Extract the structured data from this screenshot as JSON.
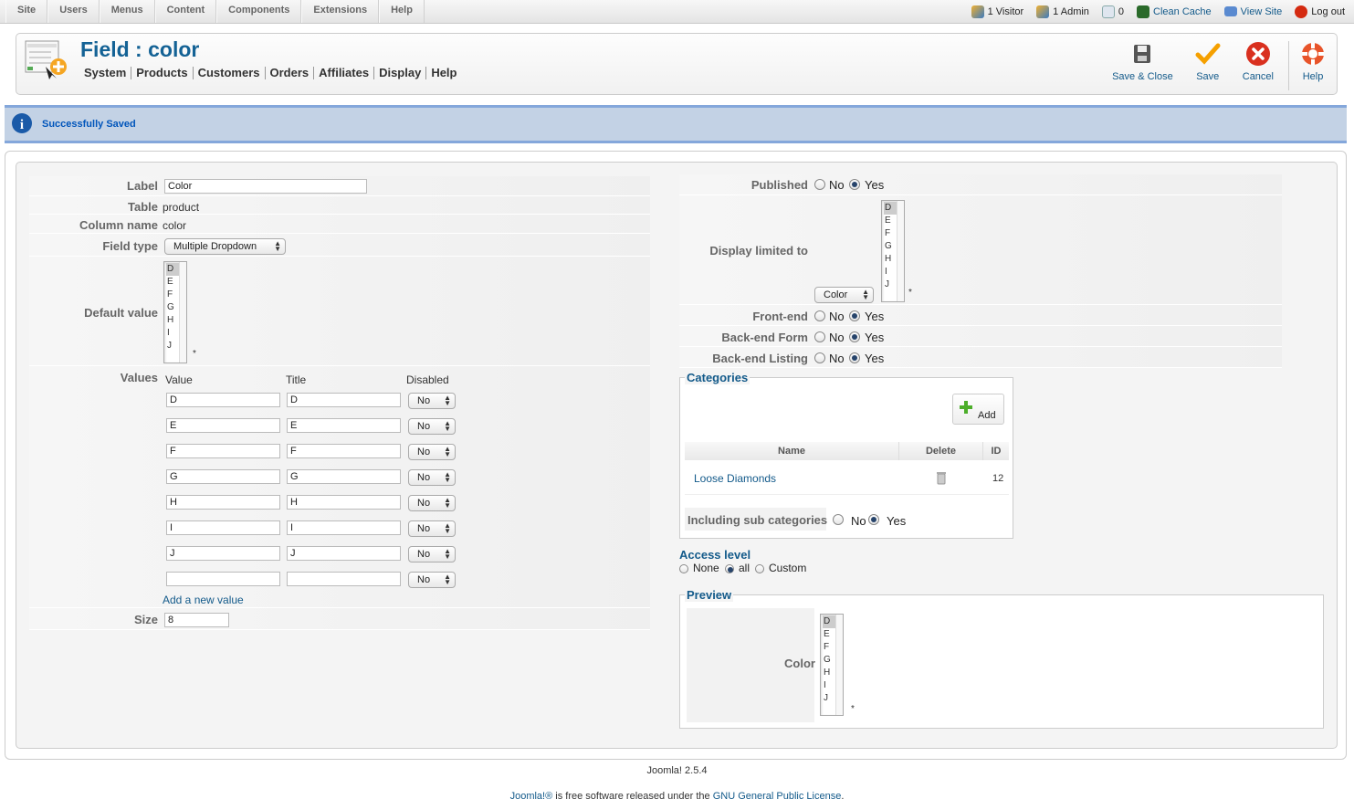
{
  "topmenu": [
    "Site",
    "Users",
    "Menus",
    "Content",
    "Components",
    "Extensions",
    "Help"
  ],
  "status": {
    "visitor": "1 Visitor",
    "admin": "1 Admin",
    "messages": "0",
    "clean_cache": "Clean Cache",
    "view_site": "View Site",
    "logout": "Log out"
  },
  "header": {
    "title": "Field : color",
    "submenu": [
      "System",
      "Products",
      "Customers",
      "Orders",
      "Affiliates",
      "Display",
      "Help"
    ]
  },
  "toolbar": {
    "save_close": "Save & Close",
    "save": "Save",
    "cancel": "Cancel",
    "help": "Help"
  },
  "message": "Successfully Saved",
  "form": {
    "label_label": "Label",
    "label_value": "Color",
    "table_label": "Table",
    "table_value": "product",
    "column_label": "Column name",
    "column_value": "color",
    "fieldtype_label": "Field type",
    "fieldtype_value": "Multiple Dropdown",
    "default_label": "Default value",
    "options": [
      "D",
      "E",
      "F",
      "G",
      "H",
      "I",
      "J"
    ],
    "values_label": "Values",
    "col_value": "Value",
    "col_title": "Title",
    "col_disabled": "Disabled",
    "values": [
      {
        "value": "D",
        "title": "D",
        "disabled": "No"
      },
      {
        "value": "E",
        "title": "E",
        "disabled": "No"
      },
      {
        "value": "F",
        "title": "F",
        "disabled": "No"
      },
      {
        "value": "G",
        "title": "G",
        "disabled": "No"
      },
      {
        "value": "H",
        "title": "H",
        "disabled": "No"
      },
      {
        "value": "I",
        "title": "I",
        "disabled": "No"
      },
      {
        "value": "J",
        "title": "J",
        "disabled": "No"
      },
      {
        "value": "",
        "title": "",
        "disabled": "No"
      }
    ],
    "add_value": "Add a new value",
    "size_label": "Size",
    "size_value": "8",
    "required_mark": "*"
  },
  "right": {
    "published_label": "Published",
    "display_limited_label": "Display limited to",
    "display_limited_select": "Color",
    "frontend_label": "Front-end",
    "backend_form_label": "Back-end Form",
    "backend_listing_label": "Back-end Listing",
    "no": "No",
    "yes": "Yes",
    "categories_legend": "Categories",
    "add": "Add",
    "th_name": "Name",
    "th_delete": "Delete",
    "th_id": "ID",
    "category_name": "Loose Diamonds",
    "category_id": "12",
    "including_sub": "Including sub categories",
    "access_legend": "Access level",
    "access_none": "None",
    "access_all": "all",
    "access_custom": "Custom",
    "preview_legend": "Preview",
    "preview_label": "Color"
  },
  "footer": {
    "version": "Joomla! 2.5.4",
    "license_link": "Joomla!®",
    "license_text": " is free software released under the ",
    "gpl": "GNU General Public License",
    "end": "."
  }
}
